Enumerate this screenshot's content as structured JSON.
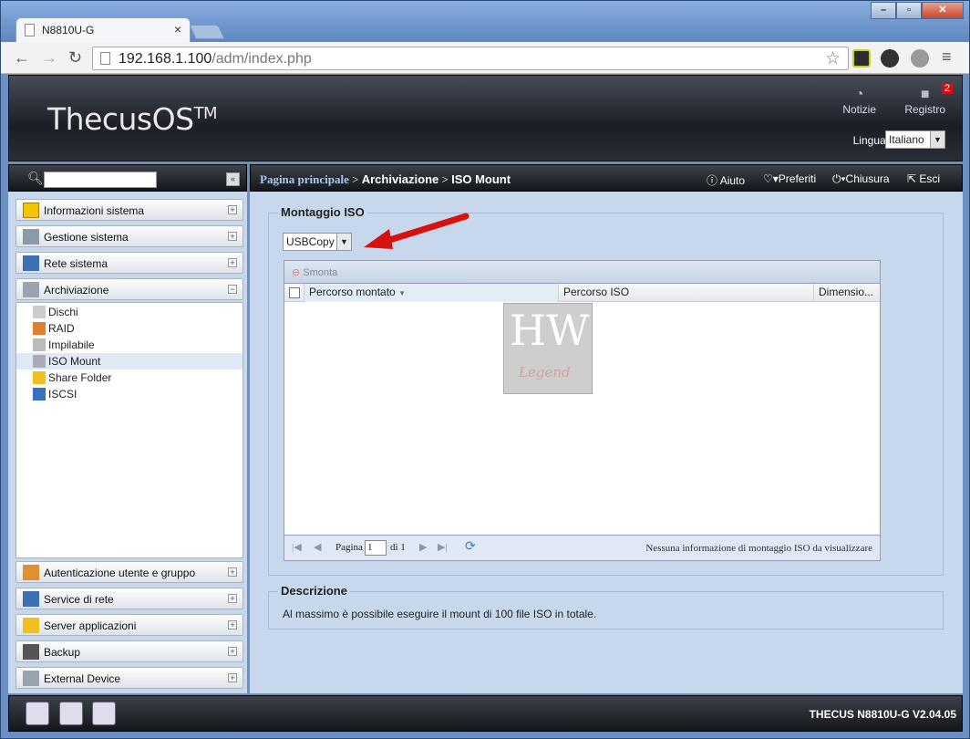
{
  "browser": {
    "tab_title": "N8810U-G",
    "url_host": "192.168.1.100",
    "url_path": "/adm/index.php",
    "window_buttons": [
      "–",
      "▫",
      "✕"
    ]
  },
  "header": {
    "logo_text": "ThecusOS",
    "logo_tm": "TM",
    "notizie_label": "Notizie",
    "registro_label": "Registro",
    "registro_badge": "2",
    "lingua_label": "Lingua:",
    "lingua_value": "Italiano"
  },
  "sidebar": {
    "menus_top": [
      {
        "label": "Informazioni sistema",
        "icon": "info-icon",
        "toggle": "+"
      },
      {
        "label": "Gestione sistema",
        "icon": "tools-icon",
        "toggle": "+"
      },
      {
        "label": "Rete sistema",
        "icon": "network-icon",
        "toggle": "+"
      },
      {
        "label": "Archiviazione",
        "icon": "storage-icon",
        "toggle": "−"
      }
    ],
    "storage_items": [
      {
        "label": "Dischi",
        "icon": "disk-icon"
      },
      {
        "label": "RAID",
        "icon": "raid-icon"
      },
      {
        "label": "Impilabile",
        "icon": "stack-icon"
      },
      {
        "label": "ISO Mount",
        "icon": "iso-icon"
      },
      {
        "label": "Share Folder",
        "icon": "folder-icon"
      },
      {
        "label": "ISCSI",
        "icon": "iscsi-icon"
      }
    ],
    "menus_bottom": [
      {
        "label": "Autenticazione utente e gruppo",
        "icon": "users-icon",
        "toggle": "+"
      },
      {
        "label": "Service di rete",
        "icon": "network-service-icon",
        "toggle": "+"
      },
      {
        "label": "Server applicazioni",
        "icon": "app-server-icon",
        "toggle": "+"
      },
      {
        "label": "Backup",
        "icon": "backup-icon",
        "toggle": "+"
      },
      {
        "label": "External Device",
        "icon": "external-device-icon",
        "toggle": "+"
      }
    ]
  },
  "breadcrumb": {
    "home": "Pagina principale",
    "sep": ">",
    "section": "Archiviazione",
    "current": "ISO Mount"
  },
  "toolbar": {
    "aiuto": "Aiuto",
    "preferiti": "Preferiti",
    "chiusura": "Chiusura",
    "esci": "Esci"
  },
  "iso_panel": {
    "legend": "Montaggio ISO",
    "share_select": "USBCopy",
    "unmount_button": "Smonta",
    "columns": [
      "Percorso montato",
      "Percorso ISO",
      "Dimensio..."
    ],
    "pager_label": "Pagina",
    "page_value": "1",
    "page_of": "di 1",
    "status_text": "Nessuna informazione di montaggio ISO da visualizzare"
  },
  "description": {
    "legend": "Descrizione",
    "text": "Al massimo è possibile eseguire il mount di 100 file ISO in totale."
  },
  "watermark": {
    "top": "HW",
    "bottom": "Legend"
  },
  "footer": {
    "version": "THECUS N8810U-G V2.04.05"
  }
}
